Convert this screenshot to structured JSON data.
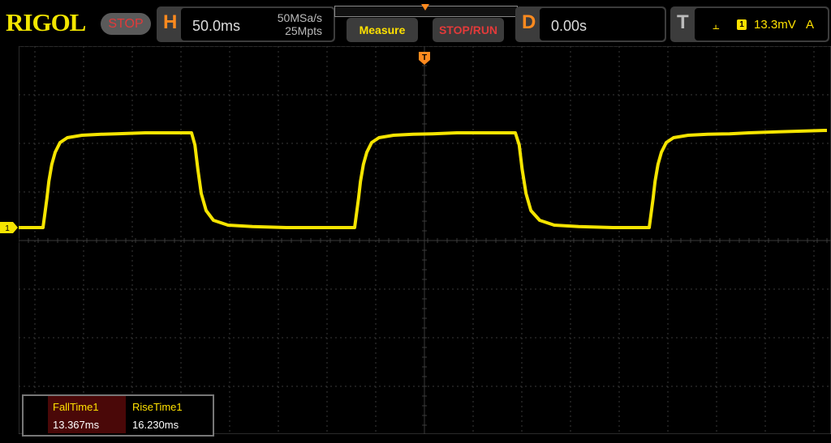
{
  "brand": "RIGOL",
  "run_state": "STOP",
  "horizontal": {
    "label": "H",
    "timebase": "50.0ms",
    "sample_rate": "50MSa/s",
    "memory_depth": "25Mpts"
  },
  "buttons": {
    "measure": "Measure",
    "stop_run": "STOP/RUN"
  },
  "delay": {
    "label": "D",
    "value": "0.00s"
  },
  "trigger": {
    "label": "T",
    "channel": "1",
    "level": "13.3mV",
    "mode": "A"
  },
  "channel_marker": "1",
  "trigger_marker": "T",
  "measurements": [
    {
      "label": "FallTime1",
      "value": "13.367ms"
    },
    {
      "label": "RiseTime1",
      "value": "16.230ms"
    }
  ],
  "colors": {
    "channel1": "#f5e400",
    "accent": "#ff8a1e",
    "stop": "#e23a3a",
    "grid": "#3a3a3a"
  },
  "chart_data": {
    "type": "line",
    "title": "",
    "series": [
      {
        "name": "",
        "x_div": [
          0,
          0.5,
          0.58,
          0.62,
          0.68,
          0.75,
          0.85,
          1.0,
          1.3,
          1.7,
          2.0,
          2.6,
          3.55,
          3.62,
          3.68,
          3.75,
          3.85,
          4.0,
          4.3,
          4.8,
          5.5,
          6.3,
          6.9,
          6.98,
          7.02,
          7.08,
          7.15,
          7.25,
          7.4,
          7.7,
          8.1,
          8.5,
          9.0,
          9.6,
          10.2,
          10.28,
          10.34,
          10.42,
          10.52,
          10.7,
          11.0,
          11.5,
          12.2,
          12.95,
          13.03,
          13.07,
          13.13,
          13.2,
          13.3,
          13.45,
          13.75,
          14.15,
          14.6,
          15.0,
          15.6,
          16.6
        ],
        "y_div": [
          0.0,
          0.0,
          0.6,
          0.95,
          1.3,
          1.55,
          1.75,
          1.85,
          1.9,
          1.92,
          1.93,
          1.95,
          1.95,
          1.7,
          1.2,
          0.7,
          0.35,
          0.15,
          0.05,
          0.02,
          0.0,
          0.0,
          0.0,
          0.6,
          0.95,
          1.3,
          1.55,
          1.75,
          1.85,
          1.9,
          1.92,
          1.93,
          1.95,
          1.95,
          1.95,
          1.7,
          1.2,
          0.7,
          0.35,
          0.15,
          0.05,
          0.02,
          0.0,
          0.0,
          0.6,
          0.95,
          1.3,
          1.55,
          1.75,
          1.85,
          1.9,
          1.92,
          1.93,
          1.95,
          1.97,
          2.0
        ]
      }
    ],
    "grid": true,
    "divisions": {
      "x": 17,
      "y": 8
    }
  }
}
